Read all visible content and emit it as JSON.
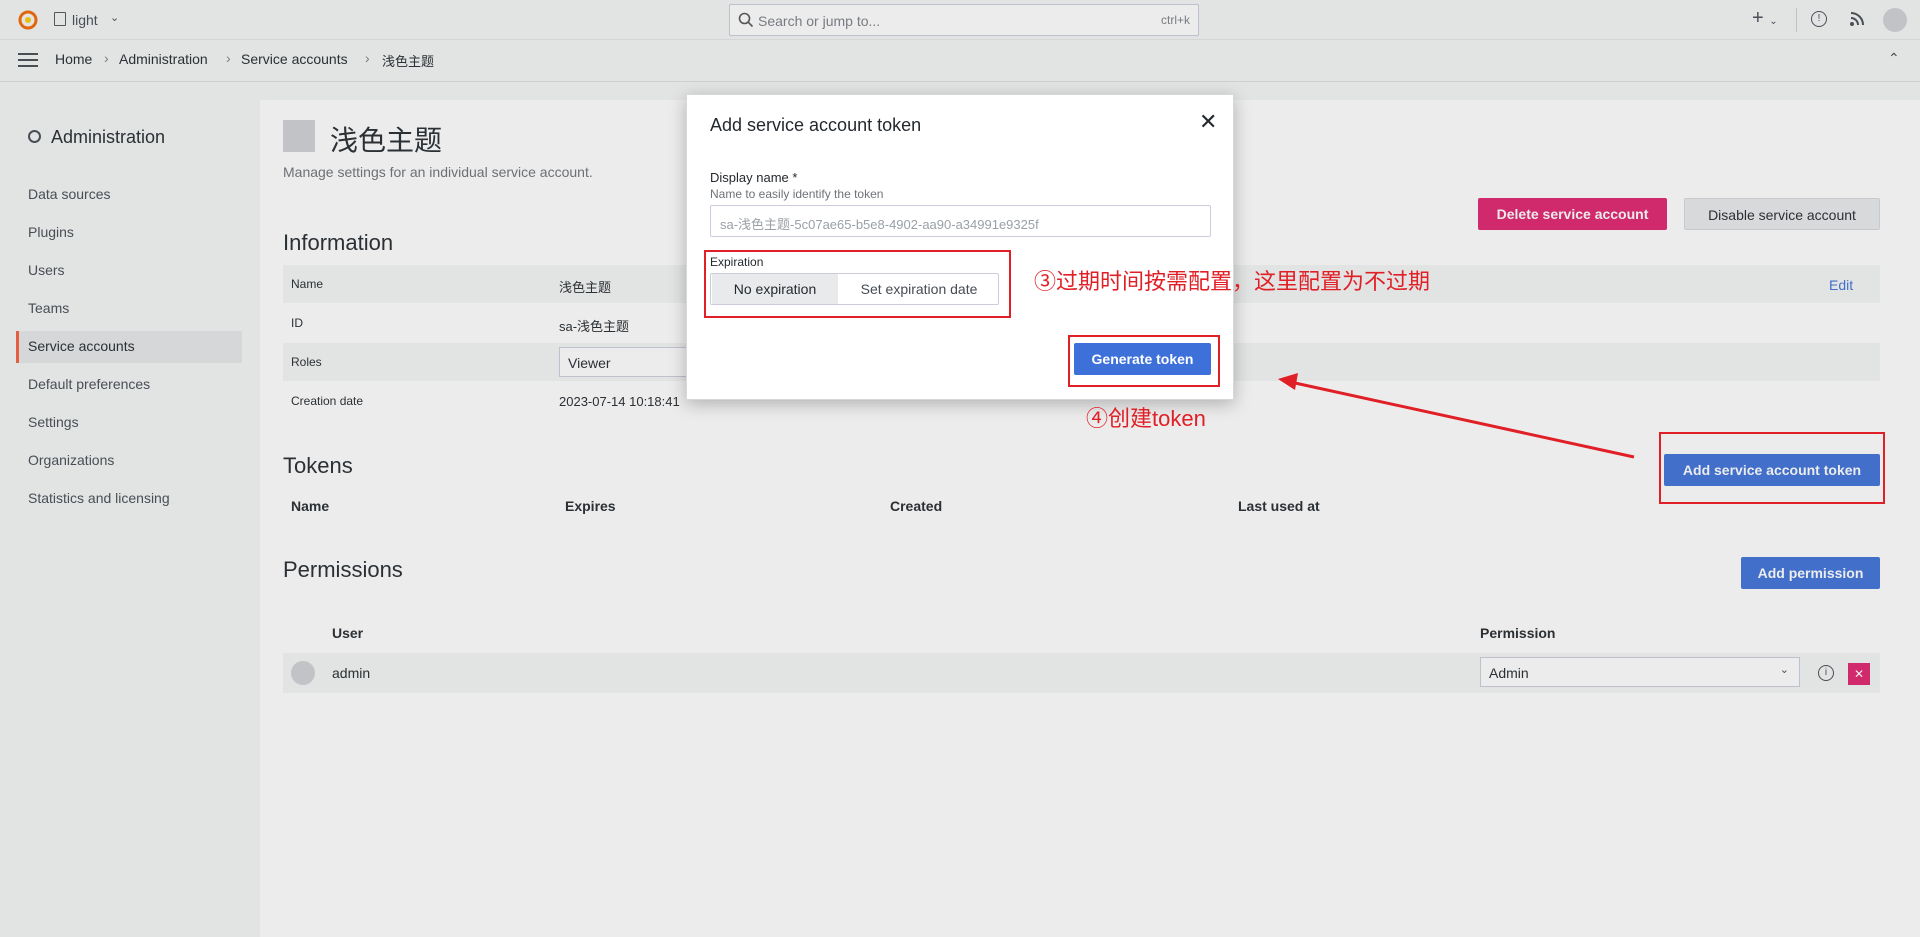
{
  "topbar": {
    "theme_label": "light",
    "search_placeholder": "Search or jump to...",
    "search_shortcut": "ctrl+k",
    "add_label": "+"
  },
  "breadcrumb": [
    "Home",
    "Administration",
    "Service accounts",
    "浅色主题"
  ],
  "sidebar": {
    "title": "Administration",
    "items": [
      {
        "label": "Data sources"
      },
      {
        "label": "Plugins"
      },
      {
        "label": "Users"
      },
      {
        "label": "Teams"
      },
      {
        "label": "Service accounts",
        "active": true
      },
      {
        "label": "Default preferences"
      },
      {
        "label": "Settings"
      },
      {
        "label": "Organizations"
      },
      {
        "label": "Statistics and licensing"
      }
    ]
  },
  "page": {
    "title": "浅色主题",
    "subtitle": "Manage settings for an individual service account.",
    "delete_label": "Delete service account",
    "disable_label": "Disable service account",
    "information_heading": "Information",
    "info": {
      "name_label": "Name",
      "name_value": "浅色主题",
      "edit_label": "Edit",
      "id_label": "ID",
      "id_value": "sa-浅色主题",
      "roles_label": "Roles",
      "roles_value": "Viewer",
      "created_label": "Creation date",
      "created_value": "2023-07-14 10:18:41"
    },
    "tokens_heading": "Tokens",
    "add_token_label": "Add service account token",
    "token_columns": [
      "Name",
      "Expires",
      "Created",
      "Last used at"
    ],
    "permissions_heading": "Permissions",
    "add_permission_label": "Add permission",
    "permission_columns": {
      "user": "User",
      "permission": "Permission"
    },
    "permission_row": {
      "user": "admin",
      "permission": "Admin"
    }
  },
  "modal": {
    "title": "Add service account token",
    "close_symbol": "✕",
    "display_name_label": "Display name *",
    "display_name_desc": "Name to easily identify the token",
    "display_name_value": "sa-浅色主题-5c07ae65-b5e8-4902-aa90-a34991e9325f",
    "expiration_label": "Expiration",
    "expiration_options": [
      "No expiration",
      "Set expiration date"
    ],
    "generate_label": "Generate token"
  },
  "annotations": {
    "step3": "③过期时间按需配置，这里配置为不过期",
    "step4": "④创建token"
  },
  "colors": {
    "accent": "#3d71d9",
    "danger": "#e0226e",
    "annotation": "#e01f26",
    "active_marker": "#f55f3e"
  }
}
